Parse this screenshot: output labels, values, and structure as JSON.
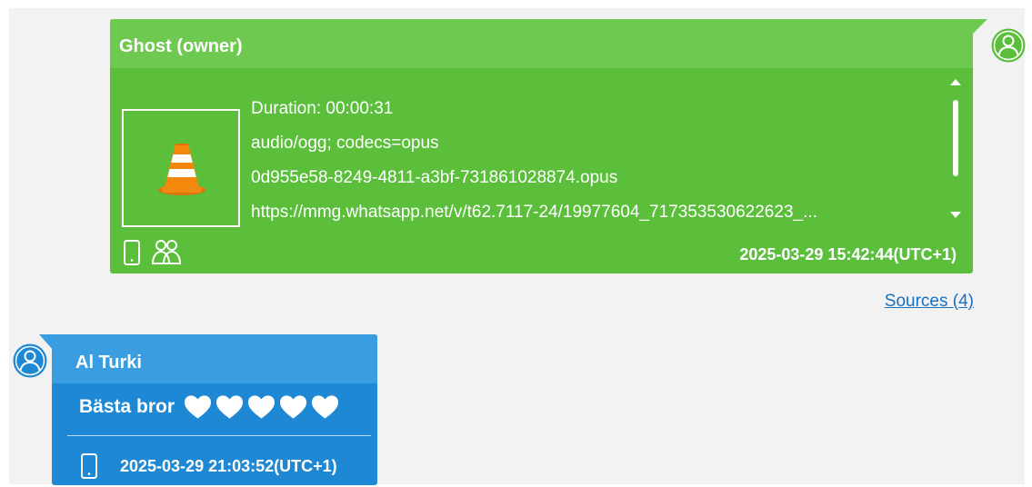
{
  "messages": {
    "owner": {
      "sender": "Ghost (owner)",
      "attachment": {
        "duration": "Duration: 00:00:31",
        "mime": "audio/ogg; codecs=opus",
        "filename": "0d955e58-8249-4811-a3bf-731861028874.opus",
        "url": "https://mmg.whatsapp.net/v/t62.7117-24/19977604_717353530622623_..."
      },
      "timestamp": "2025-03-29 15:42:44(UTC+1)",
      "icons": [
        "phone-icon",
        "group-icon",
        "vlc-cone-icon",
        "user-avatar-icon"
      ],
      "color": "#5bbf3b",
      "header_color": "#6dc94f"
    },
    "sources_link": "Sources (4)",
    "incoming": {
      "sender": "Al Turki",
      "text": "Bästa bror",
      "hearts": 5,
      "timestamp": "2025-03-29 21:03:52(UTC+1)",
      "icons": [
        "phone-icon",
        "user-avatar-icon",
        "heart-icon"
      ],
      "color": "#1e88d5",
      "header_color": "#3a9de0"
    }
  }
}
